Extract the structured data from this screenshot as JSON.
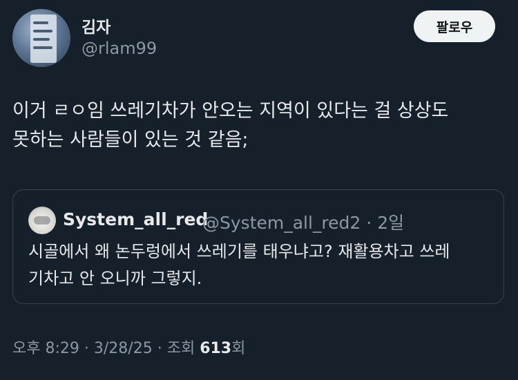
{
  "author": {
    "display_name": "김자",
    "handle": "@rlam99"
  },
  "follow_button": {
    "label": "팔로우"
  },
  "tweet": {
    "line1": "이거 ㄹㅇ임 쓰레기차가 안오는 지역이 있다는 걸 상상도",
    "line2": "못하는 사람들이 있는 것 같음;"
  },
  "quoted_tweet": {
    "display_name": "System_all_red",
    "handle": "@System_all_red2",
    "separator": "·",
    "time": "2일",
    "line1": "시골에서 왜 논두렁에서 쓰레기를 태우냐고? 재활용차고 쓰레",
    "line2": "기차고 안 오니까 그렇지."
  },
  "meta": {
    "time": "오후 8:29",
    "date": "3/28/25",
    "separator": "·",
    "views_label": "조회",
    "views_count": "613",
    "views_suffix": "회"
  },
  "colors": {
    "background": "#15202b",
    "text_primary": "#e7e9ea",
    "text_secondary": "#8b98a5",
    "border": "#38444d",
    "button_bg": "#eff3f4"
  }
}
